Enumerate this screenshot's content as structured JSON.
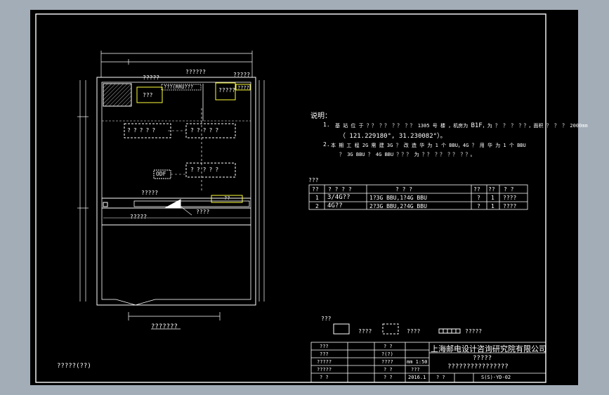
{
  "floor_plan": {
    "rooms": [
      "???",
      "??? ?",
      "?????",
      "????",
      "???"
    ],
    "shaft_label": "???(RRU???",
    "rack_cells": [
      "?",
      "?",
      "?",
      "?",
      "?"
    ],
    "odf_label": "ODF",
    "top_labels": [
      "?????",
      "??????",
      "?????"
    ],
    "mid_labels": [
      "?????",
      "?????",
      "????",
      "??"
    ],
    "caption": "???????"
  },
  "notes": {
    "heading": "说明：",
    "item1_num": "1.",
    "item1_line1": "基 站 位 于 ？？ ？？ ？？ ？？ 1305 号 楼 ，机房为 ",
    "item1_floor": "B1F",
    "item1_line1_tail": "，为 ？ ？ ？ ？？，面积 ？ ？ ？ 2000mm",
    "item1_coords": "（ 121.229180°, 31.230082°）。",
    "item2_num": "2.",
    "item2_line1": "本 期 工 程 2G 需 建 3G ？ 改 造 华 为 1 个 BBU，4G ？ 用 华 为 1 个 BBU",
    "item2_line2": "？ 3G BBU ？ 4G BBU ？？？ 为 ？？ ？？ ？？ ？？。"
  },
  "equipment_table": {
    "title": "???",
    "headers": [
      "??",
      "? ? ? ?",
      "? ? ?",
      "??",
      "??",
      "? ?"
    ],
    "rows": [
      [
        "1",
        "3/4G??",
        "1?3G BBU,1?4G BBU",
        "?",
        "1",
        "????"
      ],
      [
        "2",
        "4G??",
        "2?3G BBU,2?4G BBU",
        "?",
        "1",
        "????"
      ]
    ]
  },
  "legend": {
    "title": "???",
    "items": [
      "????",
      "????",
      "?????"
    ]
  },
  "left_caption": "?????(??)",
  "title_block": {
    "company": "上海邮电设计咨询研究院有限公司",
    "project_line1": "?????",
    "project_line2": "????????????????",
    "left_labels": [
      "???",
      "???",
      "?????",
      "?????",
      "? ?"
    ],
    "mid_labels": [
      "? ?",
      "?(?)",
      "????",
      "? ?",
      "? ?"
    ],
    "scale_unit": "mm",
    "scale_value": "1:50",
    "sheet_label": "???",
    "date": "2016.1",
    "date_label": "? ?",
    "drawing_no": "S(S)-YD-02"
  },
  "colors": {
    "background": "#000000",
    "line_white": "#ffffff",
    "line_yellow": "#ffff3a",
    "page_gray": "#a3adb8"
  }
}
